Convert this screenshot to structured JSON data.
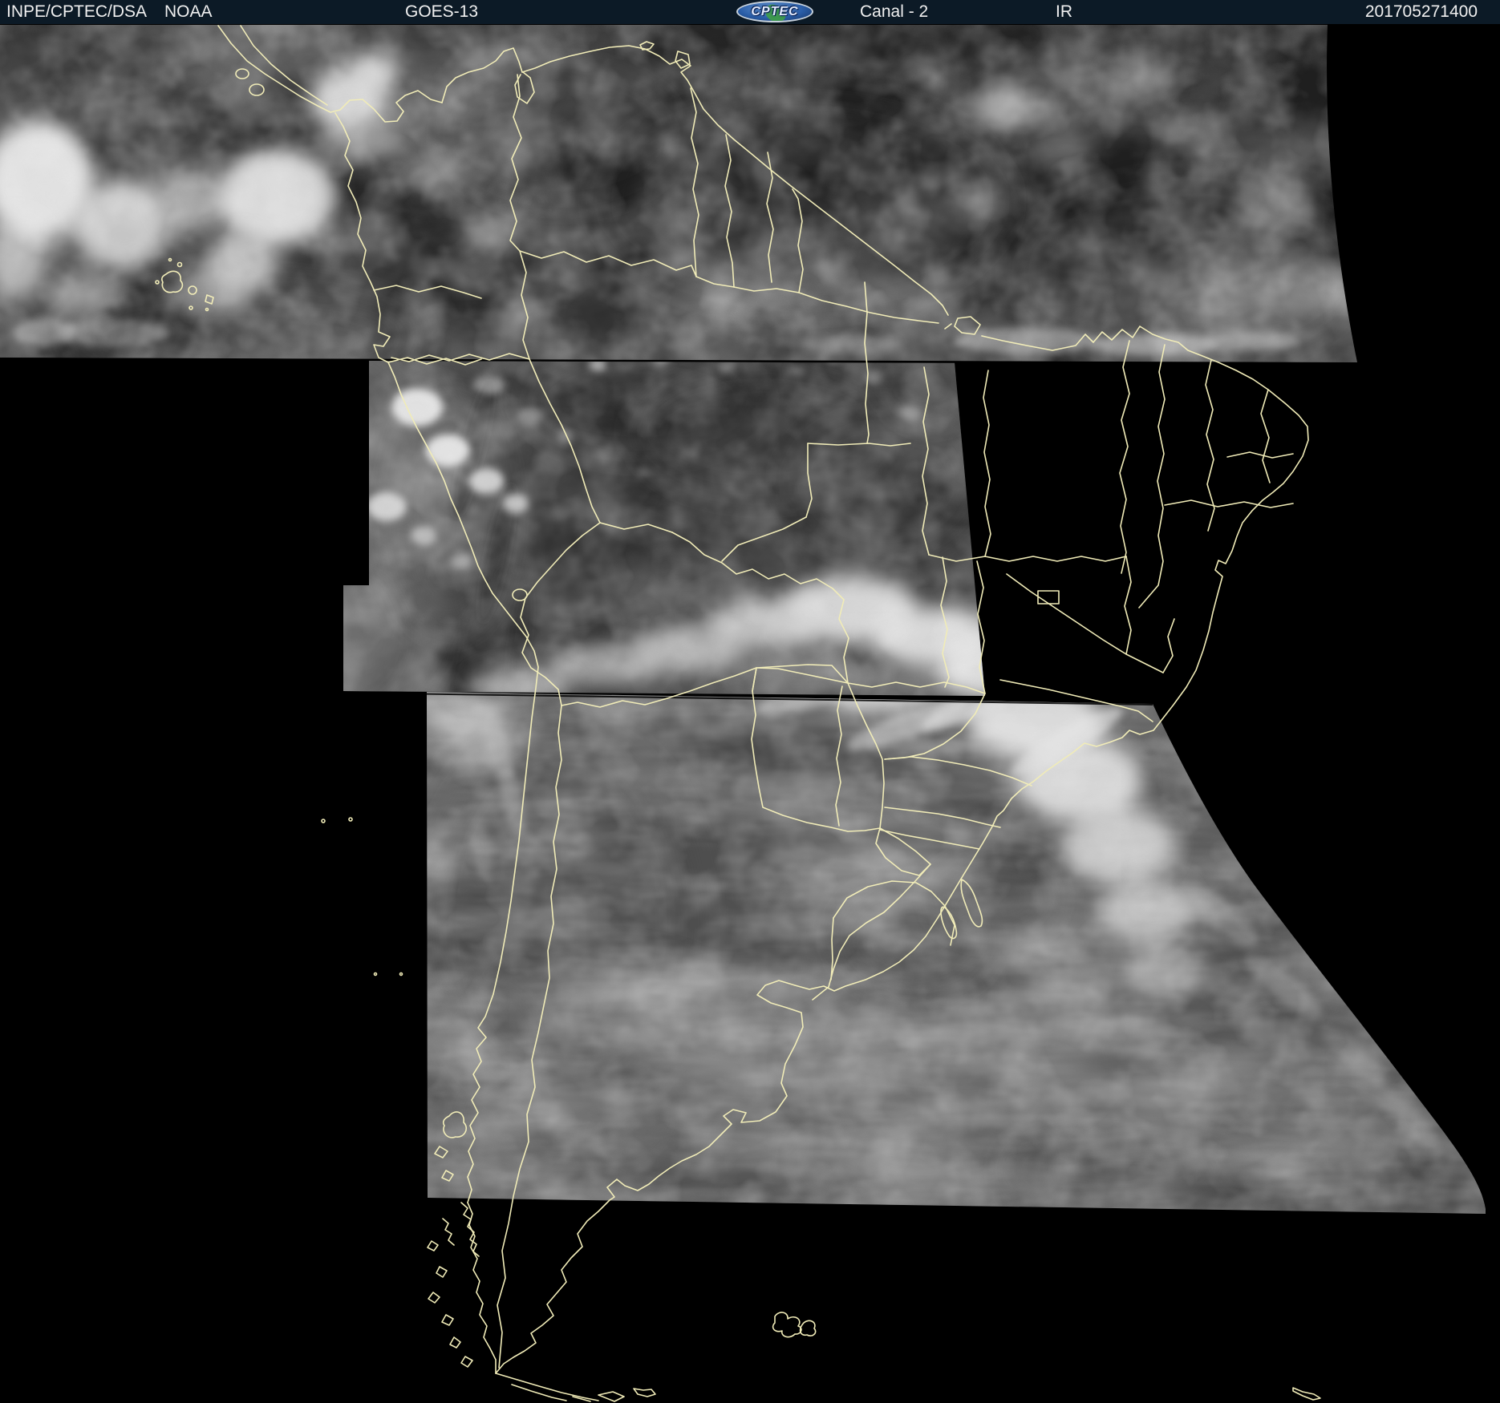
{
  "header": {
    "agency": "INPE/CPTEC/DSA",
    "noaa": "NOAA",
    "satellite": "GOES-13",
    "logo_text": "CPTEC",
    "channel": "Canal - 2",
    "band": "IR",
    "timestamp": "201705271400"
  },
  "colors": {
    "header_bg": "#0c1a26",
    "header_text": "#f0f0f0",
    "border_yellow": "#f1ecb8",
    "logo_blue": "#2a5ea8",
    "logo_green": "#3f9e46",
    "logo_ring": "#c8d2dc",
    "space_black": "#000000"
  }
}
